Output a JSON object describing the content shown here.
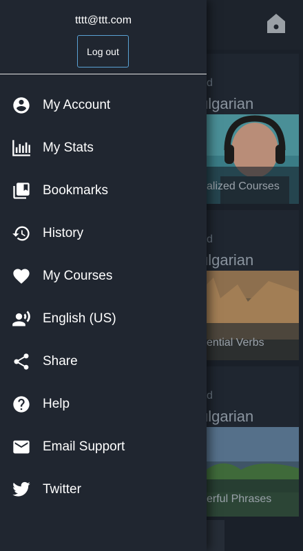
{
  "user": {
    "email": "tttt@ttt.com",
    "logout_label": "Log out"
  },
  "menu": [
    {
      "label": "My Account",
      "icon": "account-circle-icon"
    },
    {
      "label": "My Stats",
      "icon": "bar-chart-icon"
    },
    {
      "label": "Bookmarks",
      "icon": "bookmarks-icon"
    },
    {
      "label": "History",
      "icon": "history-icon"
    },
    {
      "label": "My Courses",
      "icon": "heart-icon"
    },
    {
      "label": "English (US)",
      "icon": "voice-language-icon"
    },
    {
      "label": "Share",
      "icon": "share-icon"
    },
    {
      "label": "Help",
      "icon": "help-icon"
    },
    {
      "label": "Email Support",
      "icon": "email-icon"
    },
    {
      "label": "Twitter",
      "icon": "twitter-icon"
    }
  ],
  "background": {
    "home_icon": "home-icon",
    "cards": [
      {
        "level": "d",
        "language": "ulgarian",
        "title": "alized Courses"
      },
      {
        "level": "d",
        "language": "ulgarian",
        "title": "ential Verbs"
      },
      {
        "level": "d",
        "language": "ulgarian",
        "title": "erful Phrases"
      }
    ]
  },
  "colors": {
    "drawer_bg": "#202630",
    "app_bg": "#1a2029",
    "accent_border": "#5aa3d6",
    "text": "#ffffff"
  }
}
